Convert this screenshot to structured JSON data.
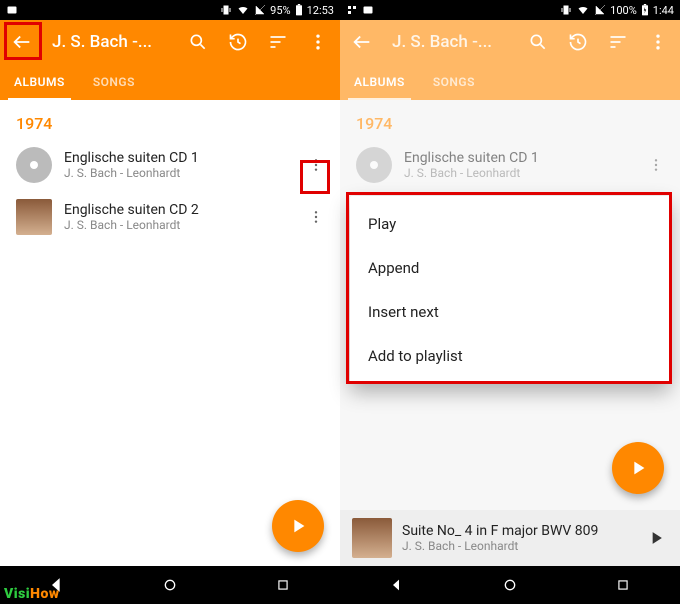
{
  "colors": {
    "accent": "#ff8800",
    "accent_dim": "#ffb866",
    "highlight": "#e00000"
  },
  "watermark": {
    "part1": "Visi",
    "part2": "How"
  },
  "left": {
    "status": {
      "battery": "95%",
      "time": "12:53"
    },
    "title": "J. S. Bach -...",
    "tabs": {
      "albums": "ALBUMS",
      "songs": "SONGS"
    },
    "year": "1974",
    "items": [
      {
        "title": "Englische suiten CD 1",
        "subtitle": "J. S. Bach - Leonhardt",
        "art": "disc"
      },
      {
        "title": "Englische suiten CD 2",
        "subtitle": "J. S. Bach - Leonhardt",
        "art": "cover"
      }
    ]
  },
  "right": {
    "status": {
      "battery": "100%",
      "time": "1:44"
    },
    "title": "J. S. Bach -...",
    "tabs": {
      "albums": "ALBUMS",
      "songs": "SONGS"
    },
    "year": "1974",
    "items": [
      {
        "title": "Englische suiten CD 1",
        "subtitle": "J. S. Bach - Leonhardt",
        "art": "disc"
      }
    ],
    "menu": {
      "play": "Play",
      "append": "Append",
      "insert": "Insert next",
      "add": "Add to playlist"
    },
    "mini": {
      "title": "Suite No_ 4 in F major BWV 809",
      "subtitle": "J. S. Bach - Leonhardt"
    }
  }
}
